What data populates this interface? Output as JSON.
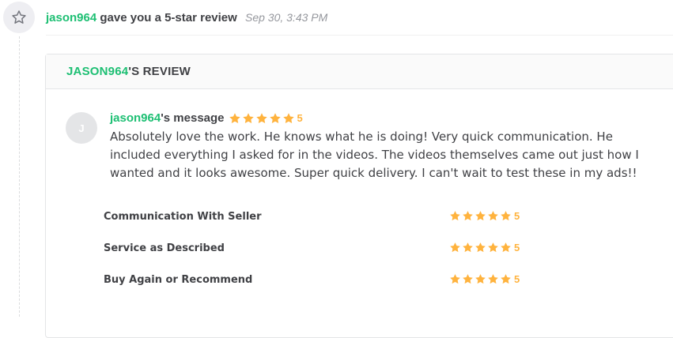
{
  "notification": {
    "username": "jason964",
    "action_text": "gave you a 5-star review",
    "date": "Sep 30, 3:43 PM",
    "icon": "star-outline-icon"
  },
  "review": {
    "header_user": "JASON964",
    "header_suffix": "'S REVIEW",
    "avatar_initial": "J",
    "author": "jason964",
    "message_suffix": "'s message",
    "score": "5",
    "stars": 5,
    "message": "Absolutely love the work. He knows what he is doing! Very quick communication. He included everything I asked for in the videos. The videos themselves came out just how I wanted and it looks awesome. Super quick delivery. I can't wait to test these in my ads!!"
  },
  "ratings": [
    {
      "label": "Communication With Seller",
      "score": "5",
      "stars": 5
    },
    {
      "label": "Service as Described",
      "score": "5",
      "stars": 5
    },
    {
      "label": "Buy Again or Recommend",
      "score": "5",
      "stars": 5
    }
  ],
  "colors": {
    "brand_green": "#1dbf73",
    "star_orange": "#ffb33e",
    "text_dark": "#404145",
    "text_muted": "#95979d"
  }
}
